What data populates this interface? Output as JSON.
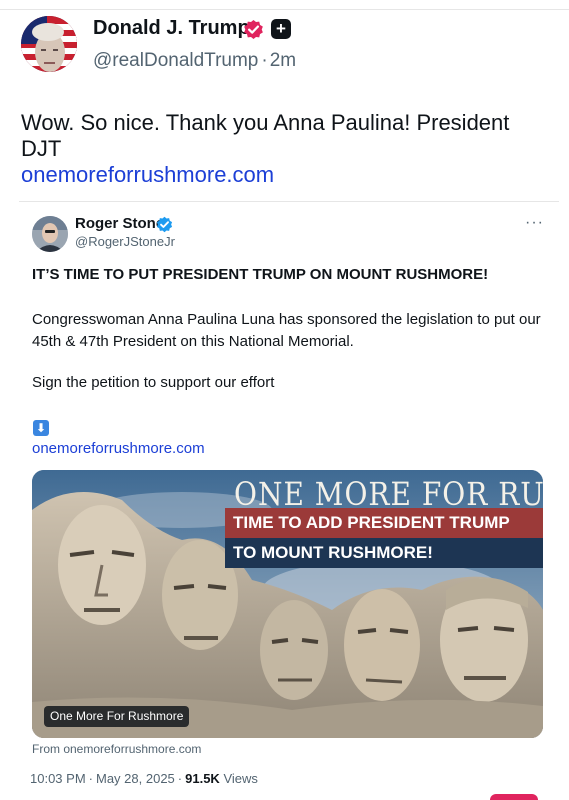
{
  "post": {
    "author_name": "Donald J. Trump",
    "author_handle": "@realDonaldTrump",
    "separator": "·",
    "time_ago": "2m",
    "text": "Wow. So nice. Thank you Anna Paulina! President DJT",
    "link": "onemoreforrushmore.com",
    "icons": [
      "avatar",
      "verified-badge-icon",
      "plus-badge-icon"
    ],
    "colors": {
      "verified_badge": "#e0245e",
      "link": "#1c3fd6"
    }
  },
  "quote": {
    "author_name": "Roger Stone",
    "author_handle": "@RogerJStoneJr",
    "more_label": "···",
    "headline": "IT’S TIME TO PUT PRESIDENT TRUMP ON MOUNT RUSHMORE!",
    "paragraph": "Congresswoman Anna Paulina Luna has sponsored the legislation to put our 45th & 47th President on this National Memorial.",
    "sign_line": "Sign the petition to support our effort",
    "arrow_glyph": "⬇",
    "link": "onemoreforrushmore.com",
    "colors": {
      "verified_badge": "#1d9bf0"
    }
  },
  "link_card": {
    "banner_title": "ONE MORE FOR RUSHMORE",
    "banner_line1": "TIME TO ADD PRESIDENT TRUMP",
    "banner_line2": "TO MOUNT RUSHMORE!",
    "label": "One More For Rushmore",
    "from_text": "From onemoreforrushmore.com",
    "colors": {
      "red_band": "#9b3a39",
      "navy_band": "#1d3553"
    }
  },
  "meta": {
    "time": "10:03 PM",
    "date": "May 28, 2025",
    "separator": "·",
    "views_count": "91.5K",
    "views_label": "Views"
  }
}
